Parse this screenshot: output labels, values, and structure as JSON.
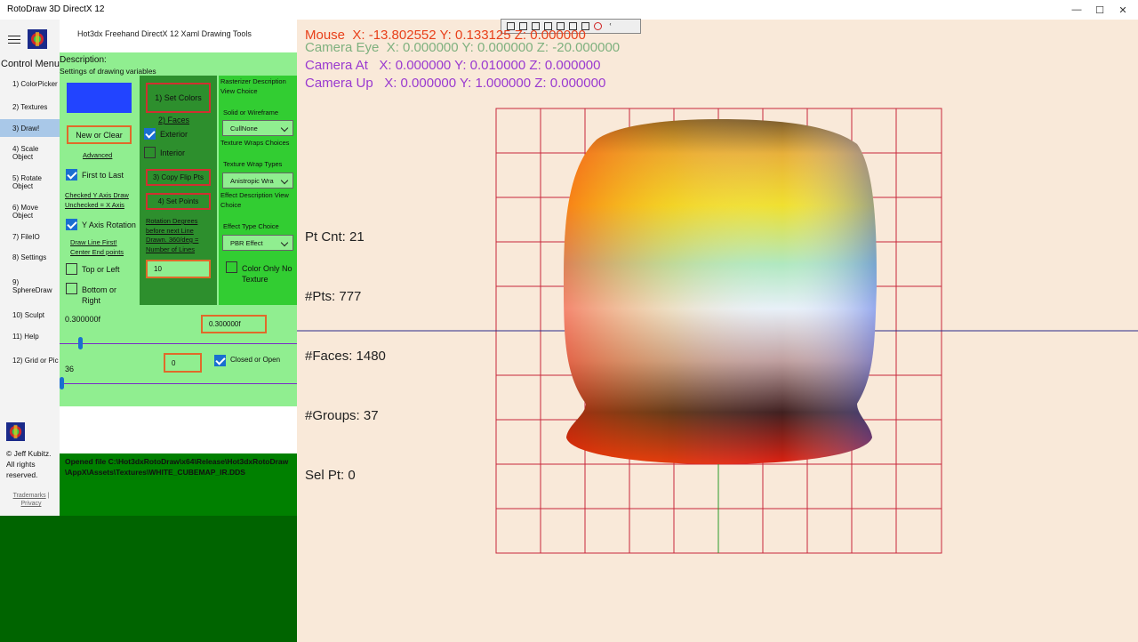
{
  "app_title": "RotoDraw 3D DirectX 12",
  "window": {
    "minimize": "—",
    "maximize": "☐",
    "close": "✕"
  },
  "header_title": "Hot3dx Freehand DirectX 12 Xaml Drawing Tools",
  "nav": {
    "title": "Control Menu",
    "items": [
      {
        "label": "1) ColorPicker"
      },
      {
        "label": "2) Textures"
      },
      {
        "label": "3) Draw!"
      },
      {
        "label": "4) Scale Object"
      },
      {
        "label": "5) Rotate Object"
      },
      {
        "label": "6) Move Object"
      },
      {
        "label": "7) FileIO"
      },
      {
        "label": "8) Settings"
      },
      {
        "label": "9) SphereDraw"
      },
      {
        "label": "10) Sculpt"
      },
      {
        "label": "11) Help"
      },
      {
        "label": "12) Grid or Pic"
      }
    ],
    "selected_index": 2,
    "copyright": "© Jeff Kubitz. All rights reserved.",
    "trademarks": "Trademarks",
    "privacy": "Privacy"
  },
  "panel": {
    "description_label": "Description:",
    "description_text": "Settings of drawing variables",
    "color_swatch": "#2244ff",
    "new_or_clear": "New or Clear",
    "advanced": "Advanced",
    "first_to_last": "First to Last",
    "axis_note_1": "Checked Y Axis Draw",
    "axis_note_2": "Unchecked = X Axis",
    "y_axis_rotation": "Y Axis Rotation",
    "draw_line_first_1": "Draw Line First!",
    "draw_line_first_2": "Center End points",
    "top_or_left": "Top or Left",
    "bottom_or_right": "Bottom or Right",
    "set_colors": "1) Set Colors",
    "faces": "2) Faces",
    "exterior": "Exterior",
    "interior": "Interior",
    "copy_flip_pts": "3) Copy Flip Pts",
    "set_points": "4) Set Points",
    "rotation_note": "Rotation Degrees before next Line Drawn. 360/deg = Number of Lines",
    "rotation_value": "10",
    "rasterizer_desc": "Rasterizer Description View Choice",
    "solid_or_wireframe": "Solid or Wireframe",
    "cull_select": "CullNone",
    "texture_wraps_choices": "Texture Wraps Choices",
    "texture_wrap_types": "Texture Wrap Types",
    "wrap_select": "Anistropic Wra",
    "effect_desc": "Effect Description View Choice",
    "effect_type_choice": "Effect Type Choice",
    "effect_select": "PBR Effect",
    "color_only": "Color Only No Texture",
    "slider1_label": "0.300000f",
    "slider1_input": "0.300000f",
    "slider1_value": 0.05,
    "slider2_label": "36",
    "slider2_input": "0",
    "slider2_value": 0.0,
    "closed_or_open": "Closed or Open"
  },
  "checkboxes": {
    "first_to_last": true,
    "y_axis_rotation": true,
    "top_or_left": false,
    "bottom_or_right": false,
    "exterior": true,
    "interior": false,
    "color_only": false,
    "closed_or_open": true
  },
  "output_text": "Opened file C:\\Hot3dxRotoDraw\\x64\\Release\\Hot3dxRotoDraw\\AppX\\Assets\\Textures\\WHITE_CUBEMAP_IR.DDS",
  "viewport": {
    "mouse": "Mouse  X: -13.802552 Y: 0.133125 Z: 0.000000",
    "camera_eye": "Camera Eye  X: 0.000000 Y: 0.000000 Z: -20.000000",
    "camera_at": "Camera At   X: 0.000000 Y: 0.010000 Z: 0.000000",
    "camera_up": "Camera Up   X: 0.000000 Y: 1.000000 Z: 0.000000",
    "pt_cnt": "Pt Cnt: 21",
    "pts": "#Pts: 777",
    "faces": "#Faces: 1480",
    "groups": "#Groups: 37",
    "sel_pt": "Sel Pt: 0",
    "mouse_color": "#e8401a",
    "eye_color": "#7fb17f",
    "at_color": "#9a3ad0",
    "up_color": "#9a3ad0",
    "grid_color": "#c8283c"
  }
}
